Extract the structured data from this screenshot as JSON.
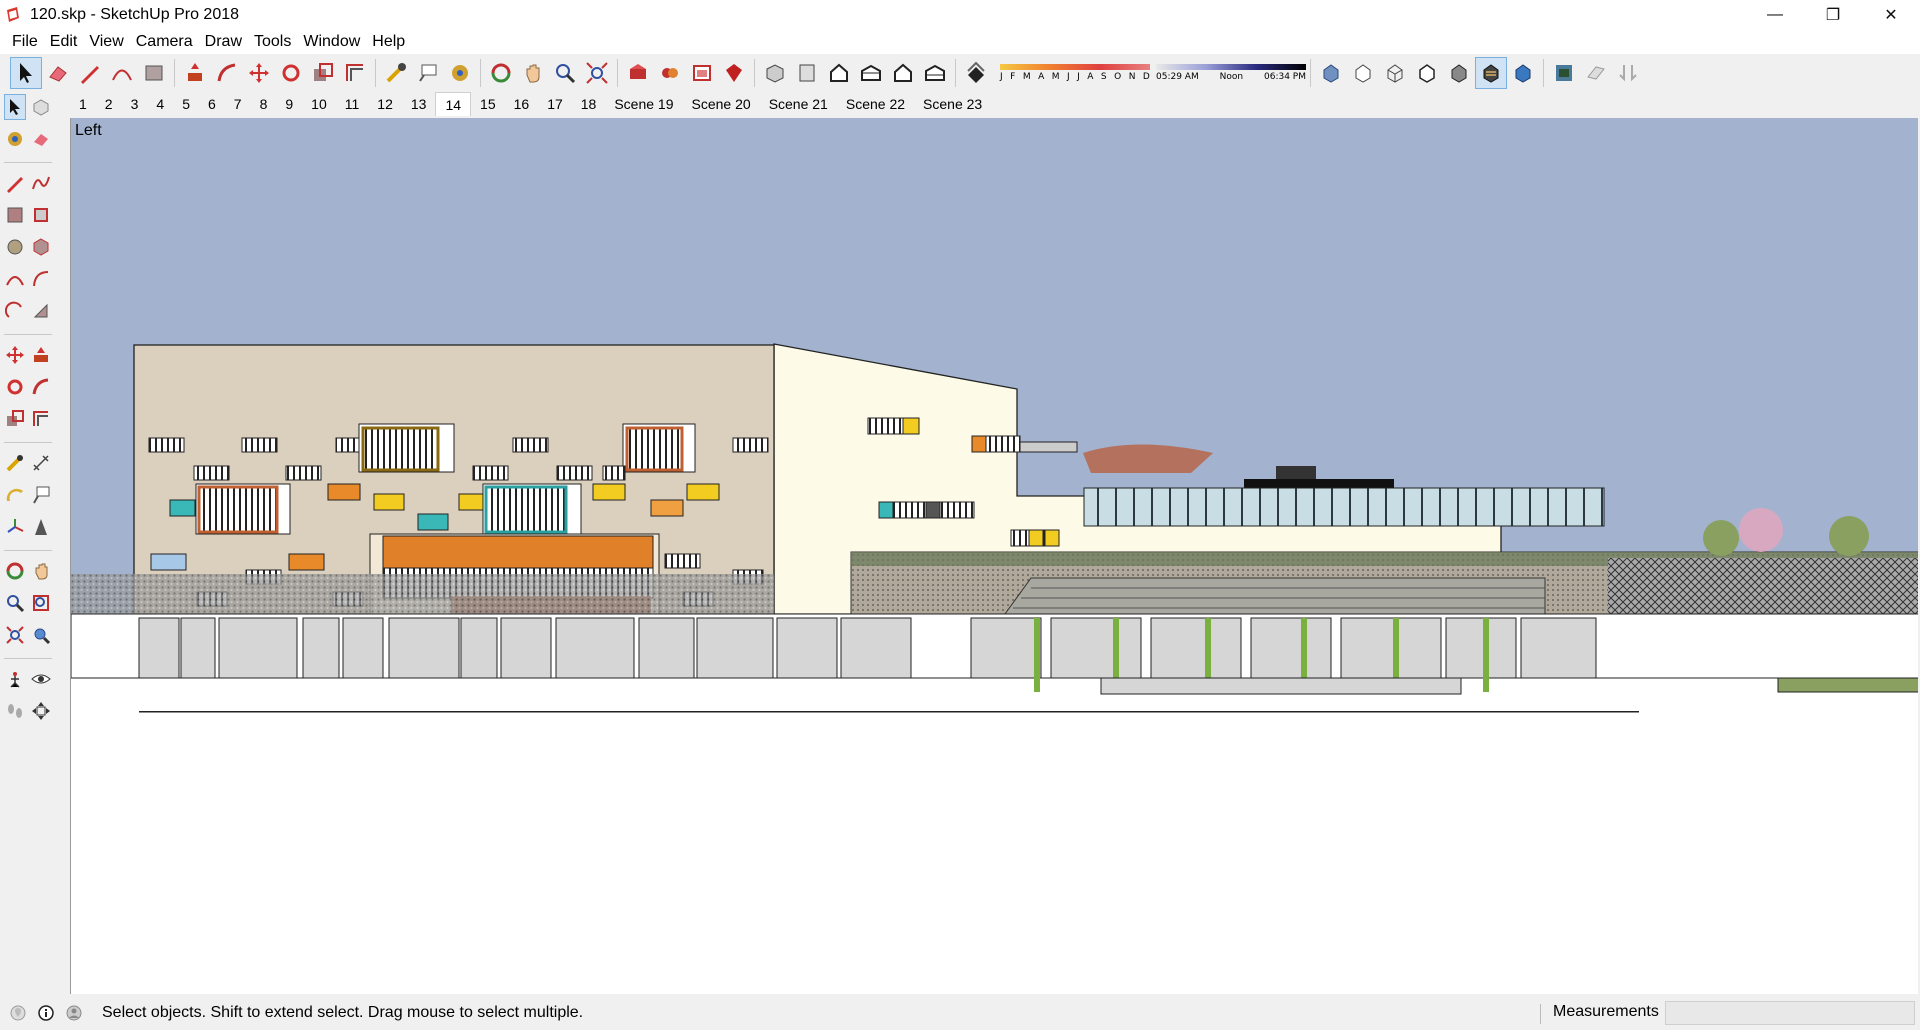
{
  "window": {
    "title": "120.skp - SketchUp Pro 2018",
    "icon": "sketchup-logo-icon",
    "minimize_glyph": "—",
    "maximize_glyph": "❐",
    "close_glyph": "✕"
  },
  "menu": [
    "File",
    "Edit",
    "View",
    "Camera",
    "Draw",
    "Tools",
    "Window",
    "Help"
  ],
  "shadow_settings": {
    "months": [
      "J",
      "F",
      "M",
      "A",
      "M",
      "J",
      "J",
      "A",
      "S",
      "O",
      "N",
      "D"
    ],
    "times": [
      "05:29 AM",
      "Noon",
      "06:34 PM"
    ]
  },
  "scenes": {
    "tabs": [
      "1",
      "2",
      "3",
      "4",
      "5",
      "6",
      "7",
      "8",
      "9",
      "10",
      "11",
      "12",
      "13",
      "14",
      "15",
      "16",
      "17",
      "18",
      "Scene 19",
      "Scene 20",
      "Scene 21",
      "Scene 22",
      "Scene 23"
    ],
    "active": "14"
  },
  "viewport": {
    "view_name": "Left",
    "sky_color": "#a3b3cf"
  },
  "status": {
    "hint": "Select objects. Shift to extend select. Drag mouse to select multiple.",
    "measurements_label": "Measurements",
    "measurements_value": ""
  },
  "colors": {
    "accent": "#d83a2e",
    "selection": "#cfe3f5"
  }
}
